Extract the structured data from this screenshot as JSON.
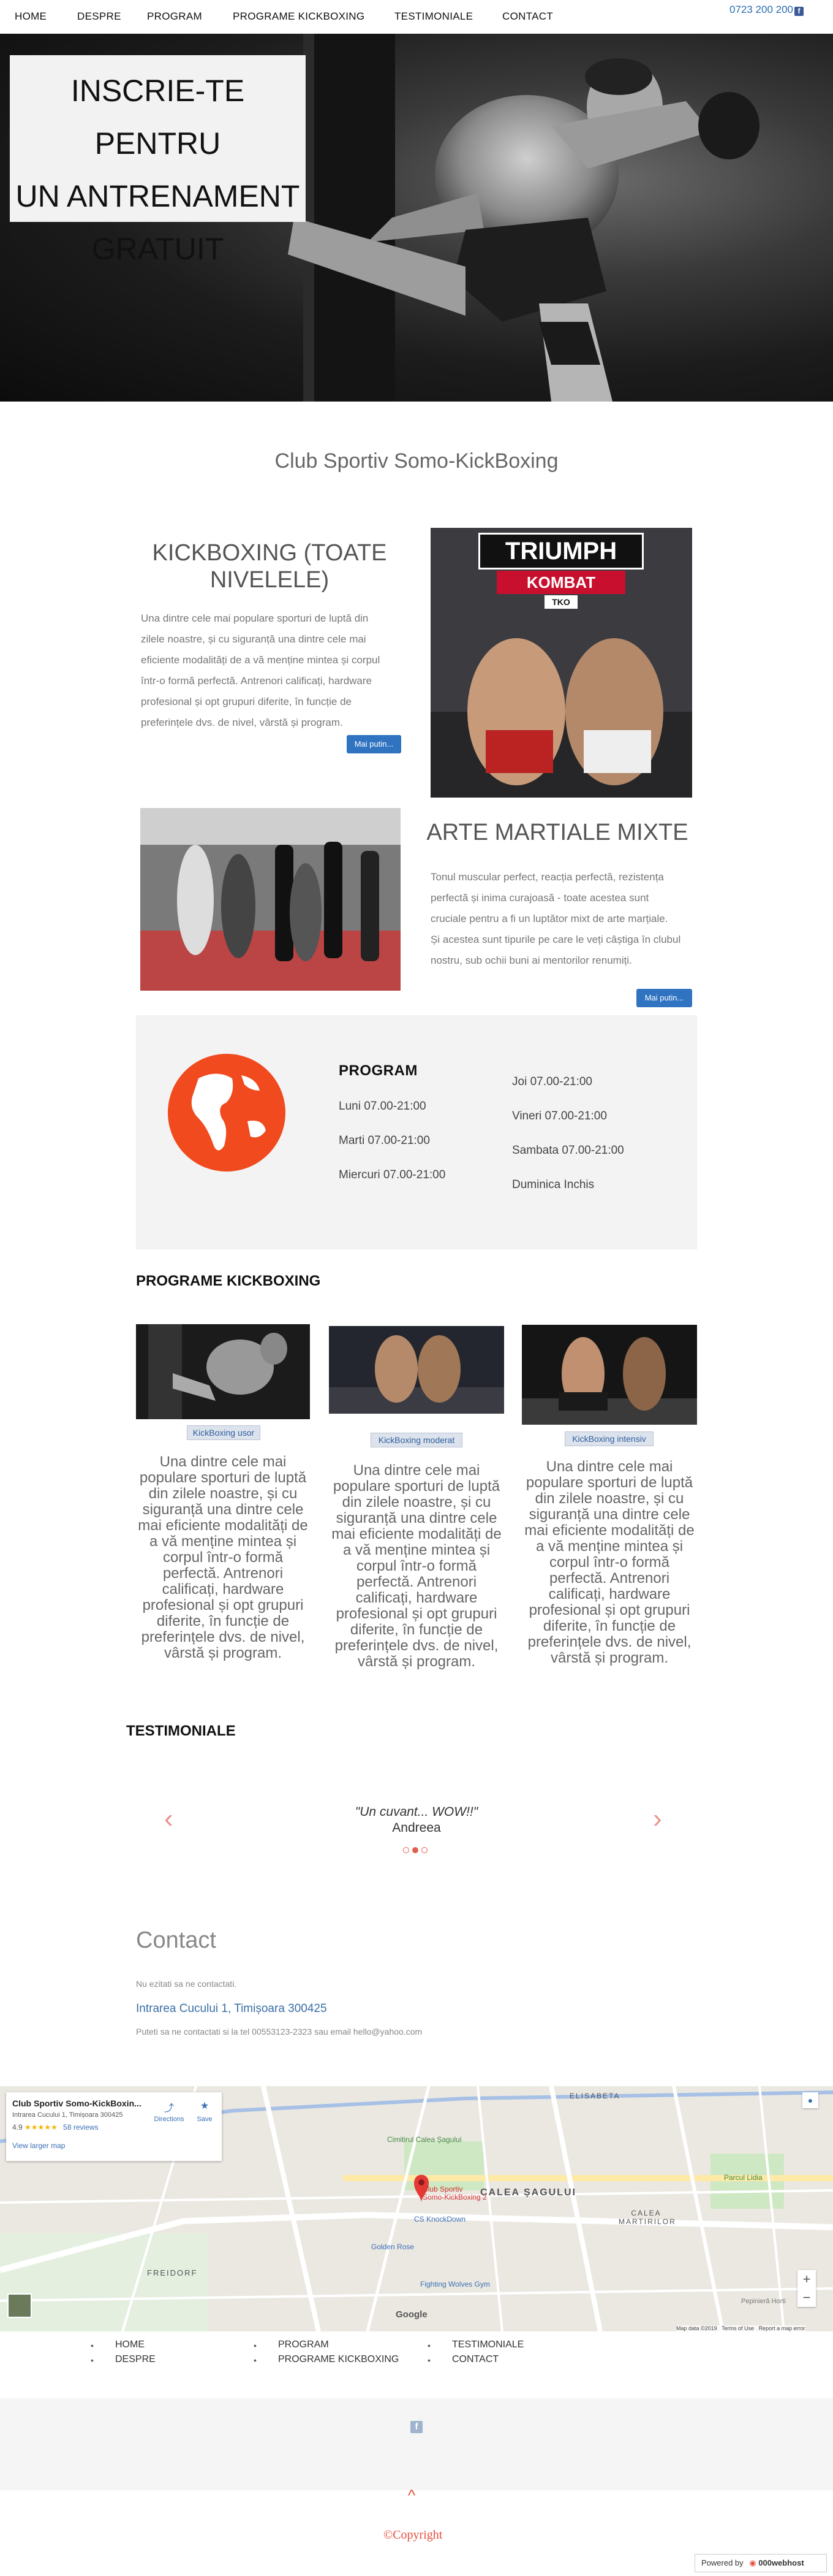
{
  "nav": {
    "items": [
      {
        "label": "HOME"
      },
      {
        "label": "DESPRE"
      },
      {
        "label": "PROGRAM"
      },
      {
        "label": "PROGRAME KICKBOXING"
      },
      {
        "label": "TESTIMONIALE"
      },
      {
        "label": "CONTACT"
      }
    ],
    "phone": "0723 200 200",
    "facebook_glyph": "f"
  },
  "hero": {
    "line1": "INSCRIE-TE PENTRU",
    "line2": "UN ANTRENAMENT",
    "line3": "GRATUIT"
  },
  "club_title": "Club Sportiv Somo-KickBoxing",
  "kickboxing": {
    "title_line1": "KICKBOXING (TOATE",
    "title_line2": "NIVELELE)",
    "lines": [
      "Una dintre cele mai populare sporturi de luptă din",
      "zilele noastre, și cu siguranță una dintre cele mai",
      "eficiente modalități de a vă menține mintea și corpul",
      "într-o formă perfectă. Antrenori calificați, hardware",
      "profesional și opt grupuri diferite, în funcție de",
      "preferințele dvs. de nivel, vârstă și program."
    ],
    "button": "Mai putin...",
    "poster_line1": "TRIUMPH",
    "poster_line2": "KOMBAT",
    "poster_line3": "TKO"
  },
  "mma": {
    "title": "ARTE MARTIALE MIXTE",
    "lines": [
      "Tonul muscular perfect, reacția perfectă, rezistența",
      "perfectă și inima curajoasă - toate acestea sunt",
      "cruciale pentru a fi un luptător mixt de arte marțiale.",
      "Și acestea sunt tipurile pe care le veți câștiga în clubul",
      "nostru, sub ochii buni ai mentorilor renumiți."
    ],
    "button": "Mai putin..."
  },
  "schedule": {
    "title": "PROGRAM",
    "left": [
      "Luni 07.00-21:00",
      "Marti 07.00-21:00",
      "Miercuri 07.00-21:00"
    ],
    "right": [
      "Joi 07.00-21:00",
      "Vineri 07.00-21:00",
      "Sambata 07.00-21:00",
      "Duminica Inchis"
    ]
  },
  "programs": {
    "title": "PROGRAME KICKBOXING",
    "cards": [
      {
        "tag": "KickBoxing usor",
        "lines": [
          "Una dintre cele mai",
          "populare sporturi de luptă",
          "din zilele noastre, și cu",
          "siguranță una dintre cele",
          "mai eficiente modalități de",
          "a vă menține mintea și",
          "corpul într-o formă",
          "perfectă. Antrenori",
          "calificați, hardware",
          "profesional și opt grupuri",
          "diferite, în funcție de",
          "preferințele dvs. de nivel,",
          "vârstă și program."
        ]
      },
      {
        "tag": "KickBoxing moderat",
        "lines": [
          "Una dintre cele mai",
          "populare sporturi de luptă",
          "din zilele noastre, și cu",
          "siguranță una dintre cele",
          "mai eficiente modalități de",
          "a vă menține mintea și",
          "corpul într-o formă",
          "perfectă. Antrenori",
          "calificați, hardware",
          "profesional și opt grupuri",
          "diferite, în funcție de",
          "preferințele dvs. de nivel,",
          "vârstă și program."
        ]
      },
      {
        "tag": "KickBoxing intensiv",
        "lines": [
          "Una dintre cele mai",
          "populare sporturi de luptă",
          "din zilele noastre, și cu",
          "siguranță una dintre cele",
          "mai eficiente modalități de",
          "a vă menține mintea și",
          "corpul într-o formă",
          "perfectă. Antrenori",
          "calificați, hardware",
          "profesional și opt grupuri",
          "diferite, în funcție de",
          "preferințele dvs. de nivel,",
          "vârstă și program."
        ]
      }
    ]
  },
  "testimonials": {
    "title": "TESTIMONIALE",
    "quote": "\"Un cuvant... WOW!!\"",
    "author": "Andreea"
  },
  "contact": {
    "title": "Contact",
    "note": "Nu ezitati sa ne contactati.",
    "address": "Intrarea Cucului 1, Timișoara 300425",
    "phone_line": "Puteti sa ne contactati si la tel 00553123-2323 sau email hello@yahoo.com"
  },
  "map": {
    "place_name": "Club Sportiv Somo-KickBoxin...",
    "place_address": "Intrarea Cucului 1, Timișoara 300425",
    "rating": "4.9",
    "stars": "★★★★★",
    "reviews": "58 reviews",
    "directions": "Directions",
    "save": "Save",
    "view_larger": "View larger map",
    "pin_label_1": "Club Sportiv",
    "pin_label_2": "Somo-KickBoxing 2",
    "labels": [
      "ELISABETA",
      "CALEA ȘAGULUI",
      "CALEA MARTIRILOR",
      "FREIDORF",
      "Parcul Lidia",
      "Cimitirul Calea Șagului",
      "CS KnockDown",
      "Golden Rose",
      "Fighting Wolves Gym",
      "Pepinieră Horti"
    ],
    "google": "Google",
    "attribution": "Map data ©2019",
    "terms": "Terms of Use",
    "report": "Report a map error",
    "zoom_in": "+",
    "zoom_out": "−"
  },
  "footer": {
    "col1": [
      "HOME",
      "DESPRE"
    ],
    "col2": [
      "PROGRAM",
      "PROGRAME KICKBOXING"
    ],
    "col3": [
      "TESTIMONIALE",
      "CONTACT"
    ],
    "bullet": "•",
    "facebook_glyph": "f",
    "up_arrow": "^",
    "copyright": "Copyright",
    "copyright_symbol": "©",
    "powered_label": "Powered by",
    "powered_brand": "000webhost"
  },
  "colors": {
    "accent_blue": "#2f73c1",
    "globe_orange": "#f04a1e",
    "copyright_red": "#e74c3c"
  }
}
